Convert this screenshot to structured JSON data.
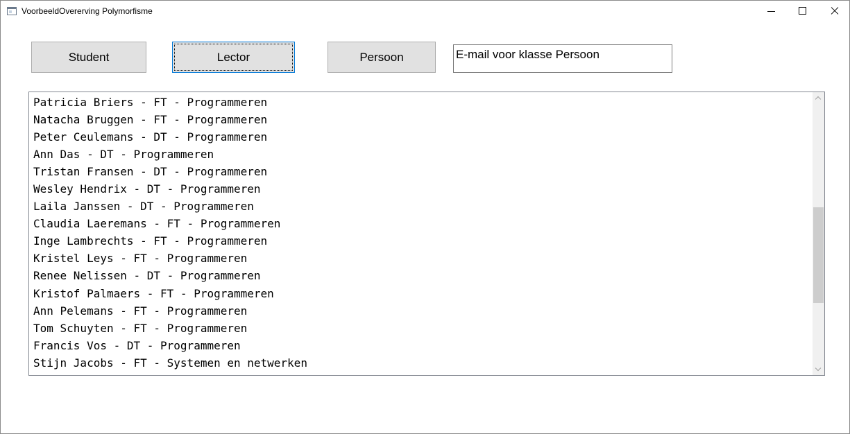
{
  "window": {
    "title": "VoorbeeldOvererving Polymorfisme"
  },
  "toolbar": {
    "student_label": "Student",
    "lector_label": "Lector",
    "persoon_label": "Persoon",
    "email_value": "E-mail voor klasse Persoon"
  },
  "list": {
    "items": [
      "Patricia Briers - FT - Programmeren",
      "Natacha Bruggen - FT - Programmeren",
      "Peter Ceulemans - DT - Programmeren",
      "Ann Das - DT - Programmeren",
      "Tristan Fransen - DT - Programmeren",
      "Wesley Hendrix - DT - Programmeren",
      "Laila Janssen - DT - Programmeren",
      "Claudia Laeremans - FT - Programmeren",
      "Inge Lambrechts - FT - Programmeren",
      "Kristel Leys - FT - Programmeren",
      "Renee Nelissen - DT - Programmeren",
      "Kristof Palmaers - FT - Programmeren",
      "Ann Pelemans - FT - Programmeren",
      "Tom Schuyten - FT - Programmeren",
      "Francis Vos - DT - Programmeren",
      "Stijn Jacobs - FT - Systemen en netwerken"
    ],
    "scroll_position": 0.45
  },
  "icons": {
    "app": "app-window-icon",
    "minimize": "minimize-icon",
    "maximize": "maximize-icon",
    "close": "close-icon"
  }
}
